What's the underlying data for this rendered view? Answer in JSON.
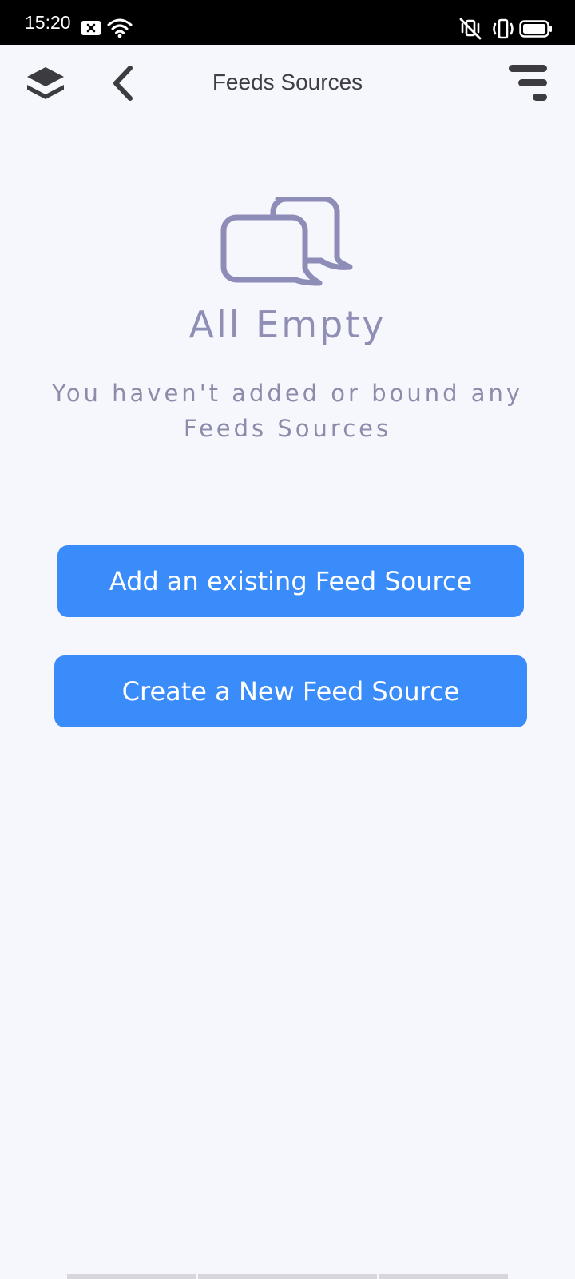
{
  "status_bar": {
    "time": "15:20",
    "icons": [
      "notification-x-icon",
      "wifi-icon",
      "vibrate-off-icon",
      "vibrate-icon",
      "battery-icon"
    ]
  },
  "toolbar": {
    "title": "Feeds Sources",
    "left_icons": [
      "layers-icon",
      "back-arrow-icon"
    ],
    "right_icon": "filter-icon"
  },
  "empty_state": {
    "icon": "chat-bubbles-icon",
    "title": "All Empty",
    "description": "You haven't added or bound any Feeds Sources"
  },
  "actions": {
    "add_existing_label": "Add an existing Feed Source",
    "create_new_label": "Create a New Feed Source"
  },
  "colors": {
    "background": "#f6f7fc",
    "accent": "#3a8cfb",
    "muted_text": "#8f8fb5",
    "title_text": "#3e3e44",
    "status_bar": "#000000"
  }
}
